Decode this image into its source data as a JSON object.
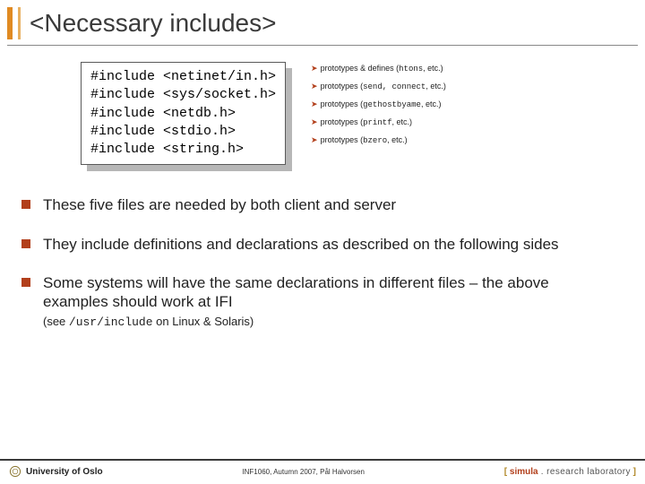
{
  "title": "<Necessary includes>",
  "code": [
    "#include <netinet/in.h>",
    "#include <sys/socket.h>",
    "#include <netdb.h>",
    "#include <stdio.h>",
    "#include <string.h>"
  ],
  "callouts": [
    {
      "prefix": "prototypes & defines (",
      "mono": "htons",
      "suffix": ", etc.)"
    },
    {
      "prefix": "prototypes (",
      "mono": "send, connect",
      "suffix": ", etc.)"
    },
    {
      "prefix": "prototypes (",
      "mono": "gethostbyame",
      "suffix": ", etc.)"
    },
    {
      "prefix": "prototypes (",
      "mono": "printf",
      "suffix": ", etc.)"
    },
    {
      "prefix": "prototypes (",
      "mono": "bzero",
      "suffix": ", etc.)"
    }
  ],
  "bullets": [
    "These five files are needed by both client and server",
    "They include definitions and declarations as described on the following sides",
    "Some systems will have the same declarations in different files – the above examples should work at IFI"
  ],
  "subnote_prefix": "(see ",
  "subnote_mono": "/usr/include",
  "subnote_suffix": " on Linux & Solaris)",
  "footer": {
    "left": "University of Oslo",
    "center": "INF1060, Autumn 2007, Pål Halvorsen",
    "bracket_l": "[ ",
    "sim": "simula",
    "dot": " . ",
    "lab": "research laboratory",
    "bracket_r": " ]"
  }
}
